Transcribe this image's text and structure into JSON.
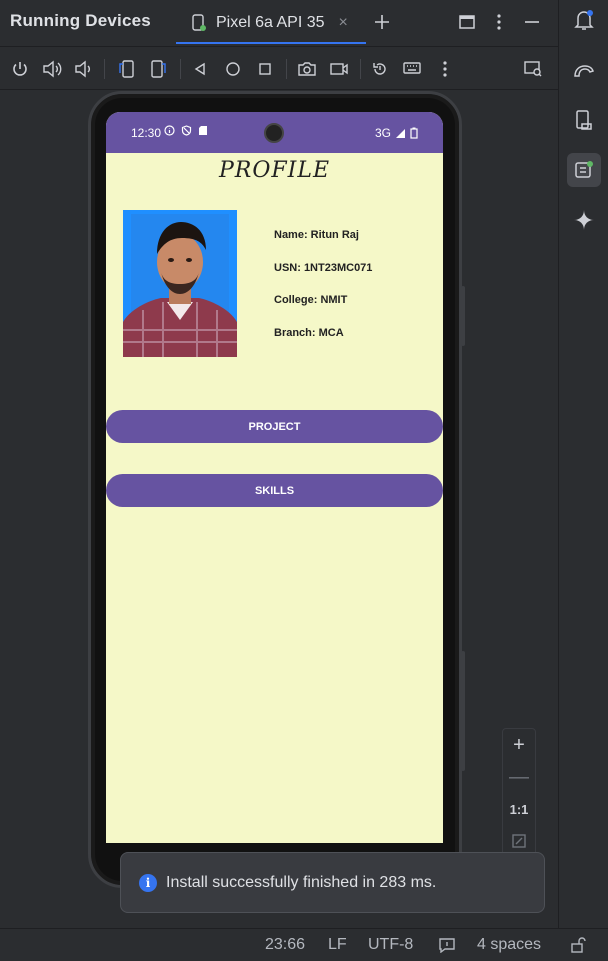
{
  "titlebar": {
    "panel_title": "Running Devices",
    "tab_label": "Pixel 6a API 35",
    "tab_close": "×"
  },
  "toolbar": {
    "icons": [
      "power-icon",
      "volume-up-icon",
      "volume-down-icon",
      "rotate-left-icon",
      "rotate-right-icon",
      "back-icon",
      "home-icon",
      "overview-icon",
      "screenshot-icon",
      "screen-record-icon",
      "reset-icon",
      "keyboard-icon",
      "more-icon",
      "device-mirror-icon"
    ]
  },
  "phone": {
    "status_time": "12:30",
    "network": "3G",
    "accent_color": "#6653a1",
    "background_color": "#f5f8c8"
  },
  "app": {
    "title": "PROFILE",
    "name": "Name: Ritun Raj",
    "usn": "USN: 1NT23MC071",
    "college": "College: NMIT",
    "branch": "Branch: MCA",
    "project_button": "PROJECT",
    "skills_button": "SKILLS"
  },
  "zoom": {
    "plus": "+",
    "minus": "—",
    "ratio": "1:1"
  },
  "notification": {
    "icon": "i",
    "text": "Install successfully finished in 283 ms."
  },
  "statusbar": {
    "position": "23:66",
    "line_ending": "LF",
    "encoding": "UTF-8",
    "indent": "4 spaces"
  }
}
